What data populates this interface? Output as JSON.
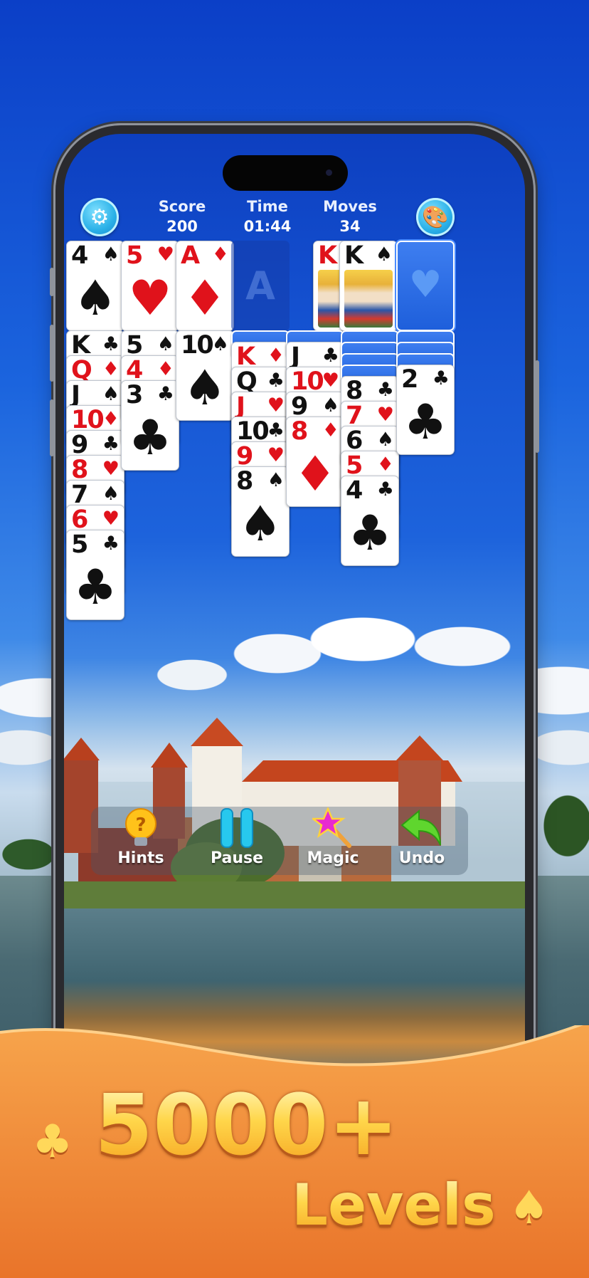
{
  "header": {
    "score_label": "Score",
    "score_value": "200",
    "time_label": "Time",
    "time_value": "01:44",
    "moves_label": "Moves",
    "moves_value": "34"
  },
  "foundations": [
    {
      "rank": "4",
      "suit": "♠",
      "color": "black"
    },
    {
      "rank": "5",
      "suit": "♥",
      "color": "red"
    },
    {
      "rank": "A",
      "suit": "♦",
      "color": "red"
    },
    {
      "placeholder": "A"
    }
  ],
  "waste": [
    {
      "rank": "K",
      "suit": "♦",
      "color": "red"
    },
    {
      "rank": "K",
      "suit": "♠",
      "color": "black"
    }
  ],
  "stock": {
    "suit": "♥"
  },
  "tableau": [
    {
      "hidden": 0,
      "cards": [
        {
          "rank": "K",
          "suit": "♣",
          "color": "black"
        },
        {
          "rank": "Q",
          "suit": "♦",
          "color": "red"
        },
        {
          "rank": "J",
          "suit": "♠",
          "color": "black"
        },
        {
          "rank": "10",
          "suit": "♦",
          "color": "red"
        },
        {
          "rank": "9",
          "suit": "♣",
          "color": "black"
        },
        {
          "rank": "8",
          "suit": "♥",
          "color": "red"
        },
        {
          "rank": "7",
          "suit": "♠",
          "color": "black"
        },
        {
          "rank": "6",
          "suit": "♥",
          "color": "red"
        },
        {
          "rank": "5",
          "suit": "♣",
          "color": "black"
        }
      ]
    },
    {
      "hidden": 0,
      "cards": [
        {
          "rank": "5",
          "suit": "♠",
          "color": "black"
        },
        {
          "rank": "4",
          "suit": "♦",
          "color": "red"
        },
        {
          "rank": "3",
          "suit": "♣",
          "color": "black"
        }
      ]
    },
    {
      "hidden": 0,
      "cards": [
        {
          "rank": "10",
          "suit": "♠",
          "color": "black"
        }
      ]
    },
    {
      "hidden": 1,
      "cards": [
        {
          "rank": "K",
          "suit": "♦",
          "color": "red"
        },
        {
          "rank": "Q",
          "suit": "♣",
          "color": "black"
        },
        {
          "rank": "J",
          "suit": "♥",
          "color": "red"
        },
        {
          "rank": "10",
          "suit": "♣",
          "color": "black"
        },
        {
          "rank": "9",
          "suit": "♥",
          "color": "red"
        },
        {
          "rank": "8",
          "suit": "♠",
          "color": "black"
        }
      ]
    },
    {
      "hidden": 1,
      "cards": [
        {
          "rank": "J",
          "suit": "♣",
          "color": "black"
        },
        {
          "rank": "10",
          "suit": "♥",
          "color": "red"
        },
        {
          "rank": "9",
          "suit": "♠",
          "color": "black"
        },
        {
          "rank": "8",
          "suit": "♦",
          "color": "red"
        }
      ]
    },
    {
      "hidden": 4,
      "cards": [
        {
          "rank": "8",
          "suit": "♣",
          "color": "black"
        },
        {
          "rank": "7",
          "suit": "♥",
          "color": "red"
        },
        {
          "rank": "6",
          "suit": "♠",
          "color": "black"
        },
        {
          "rank": "5",
          "suit": "♦",
          "color": "red"
        },
        {
          "rank": "4",
          "suit": "♣",
          "color": "black"
        }
      ]
    },
    {
      "hidden": 3,
      "cards": [
        {
          "rank": "2",
          "suit": "♣",
          "color": "black"
        }
      ]
    }
  ],
  "toolbar": {
    "hints": "Hints",
    "pause": "Pause",
    "magic": "Magic",
    "undo": "Undo"
  },
  "promo": {
    "number": "5000+",
    "word": "Levels",
    "club": "♣",
    "spade": "♠"
  },
  "colors": {
    "red_suit": "#e0121b",
    "black_suit": "#111111",
    "card_back": "#1e5fdb",
    "accent_gold": "#ffd64a"
  },
  "icons": {
    "settings": "gear-icon",
    "theme": "palette-icon",
    "hints": "lightbulb-icon",
    "pause": "pause-icon",
    "magic": "magic-wand-icon",
    "undo": "undo-arrow-icon"
  }
}
